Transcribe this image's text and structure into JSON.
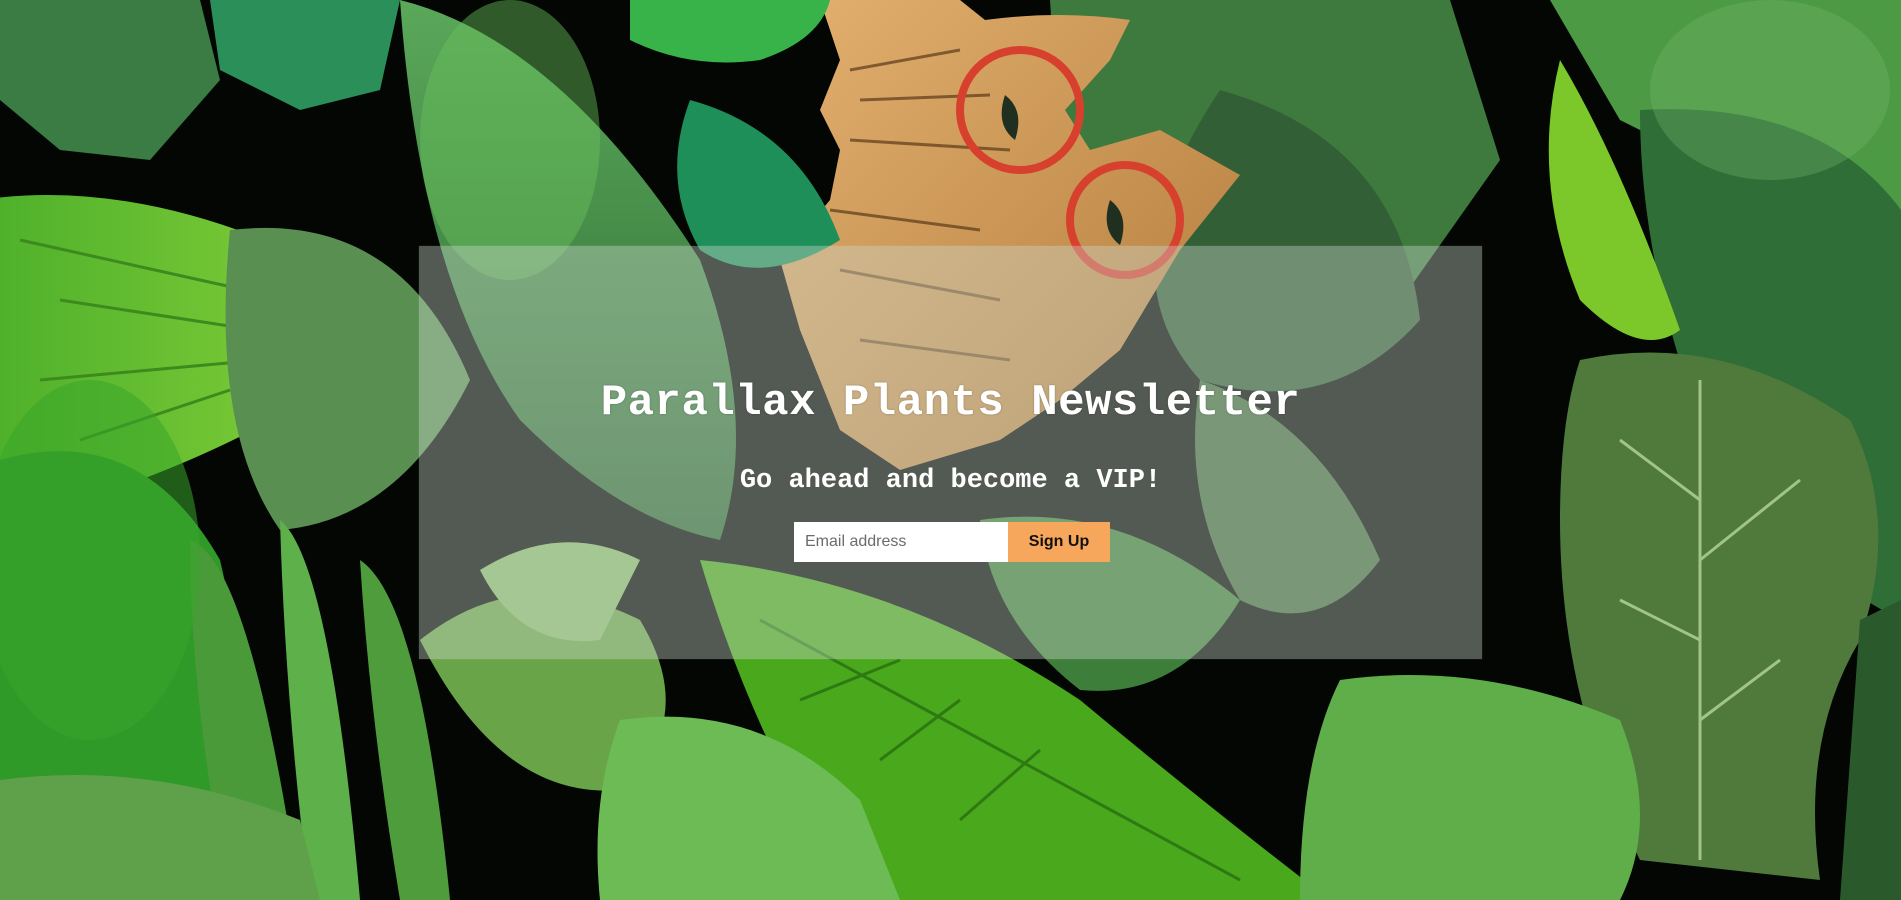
{
  "newsletter": {
    "title": "Parallax Plants Newsletter",
    "subtitle": "Go ahead and become a VIP!",
    "email_placeholder": "Email address",
    "email_value": "",
    "signup_label": "Sign Up"
  },
  "colors": {
    "panel_overlay": "#cdd7cd",
    "button_bg": "#f7a75b",
    "text": "#ffffff",
    "background": "#020402"
  },
  "icons": [
    "foliage-background-image",
    "cartoon-bird-with-glasses-image"
  ]
}
